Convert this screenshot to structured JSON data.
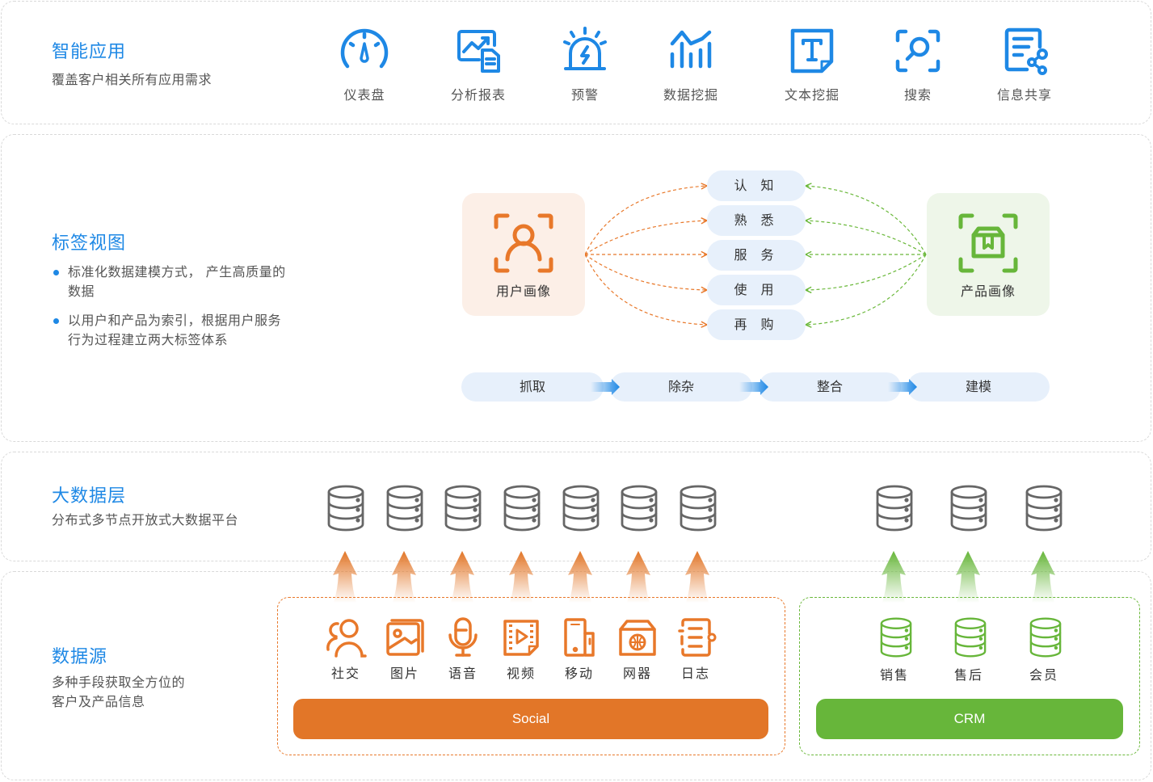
{
  "colors": {
    "title_blue": "#1e88e5",
    "social_orange": "#e27628",
    "crm_green": "#67b63a",
    "db_gray": "#666666",
    "stage_bg": "#e7f0fb"
  },
  "app_layer": {
    "title": "智能应用",
    "desc": "覆盖客户相关所有应用需求",
    "items": [
      {
        "label": "仪表盘",
        "icon": "dashboard-gauge-icon"
      },
      {
        "label": "分析报表",
        "icon": "analysis-report-icon"
      },
      {
        "label": "预警",
        "icon": "alarm-siren-icon"
      },
      {
        "label": "数据挖掘",
        "icon": "data-mining-chart-icon"
      },
      {
        "label": "文本挖掘",
        "icon": "text-mining-icon"
      },
      {
        "label": "搜索",
        "icon": "search-scan-icon"
      },
      {
        "label": "信息共享",
        "icon": "share-document-icon"
      }
    ]
  },
  "tag_view": {
    "title": "标签视图",
    "bullets": [
      "标准化数据建模方式， 产生高质量的数据",
      "以用户和产品为索引，根据用户服务行为过程建立两大标签体系"
    ],
    "user_profile": "用户画像",
    "product_profile": "产品画像",
    "stages": [
      "认 知",
      "熟 悉",
      "服 务",
      "使 用",
      "再 购"
    ],
    "process": [
      "抓取",
      "除杂",
      "整合",
      "建模"
    ]
  },
  "bigdata_layer": {
    "title": "大数据层",
    "desc": "分布式多节点开放式大数据平台",
    "social_db_count": 7,
    "crm_db_count": 3
  },
  "data_source": {
    "title": "数据源",
    "desc_lines": [
      "多种手段获取全方位的",
      "客户及产品信息"
    ],
    "social_items": [
      {
        "label": "社交",
        "icon": "social-people-icon"
      },
      {
        "label": "图片",
        "icon": "picture-icon"
      },
      {
        "label": "语音",
        "icon": "microphone-icon"
      },
      {
        "label": "视频",
        "icon": "video-icon"
      },
      {
        "label": "移动",
        "icon": "mobile-device-icon"
      },
      {
        "label": "网器",
        "icon": "network-device-icon"
      },
      {
        "label": "日志",
        "icon": "log-notebook-icon"
      }
    ],
    "social_label": "Social",
    "crm_items": [
      {
        "label": "销售",
        "icon": "sales-database-icon"
      },
      {
        "label": "售后",
        "icon": "aftersales-database-icon"
      },
      {
        "label": "会员",
        "icon": "member-database-icon"
      }
    ],
    "crm_label": "CRM"
  }
}
